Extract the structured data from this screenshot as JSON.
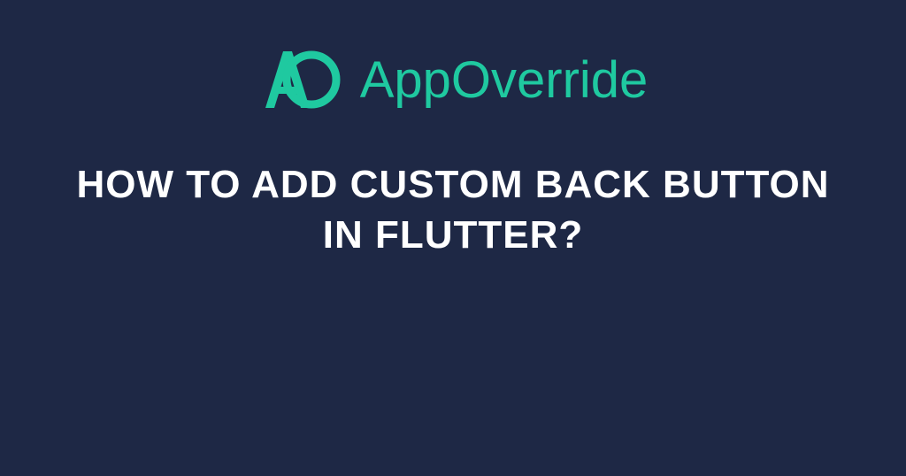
{
  "brand": {
    "name": "AppOverride",
    "logo_icon_name": "ao-logo-icon"
  },
  "title": "HOW TO ADD CUSTOM BACK BUTTON IN FLUTTER?",
  "colors": {
    "background": "#1e2845",
    "accent": "#1fc9a0",
    "text": "#ffffff"
  }
}
